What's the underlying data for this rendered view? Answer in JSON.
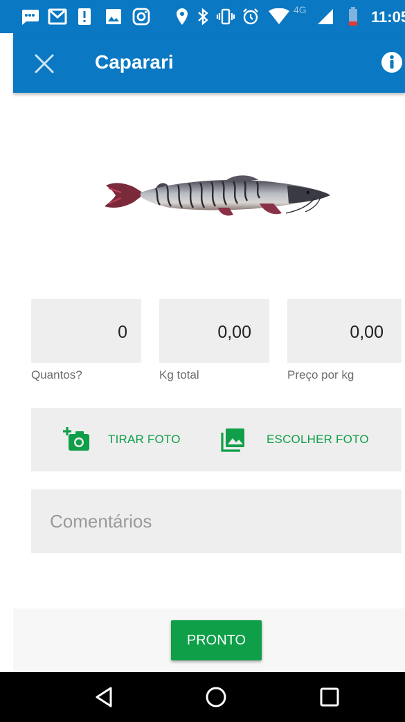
{
  "status_bar": {
    "time": "11:05",
    "network": "4G",
    "icons": [
      "sms-icon",
      "gmail-icon",
      "alert-icon",
      "gallery-icon",
      "instagram-icon",
      "location-icon",
      "bluetooth-icon",
      "vibrate-icon",
      "alarm-icon",
      "wifi-icon",
      "signal-icon",
      "battery-icon"
    ]
  },
  "app_bar": {
    "title": "Caparari",
    "close_icon": "close-icon",
    "info_icon": "info-icon",
    "color": "#0a78c2"
  },
  "fields": {
    "quantity": {
      "value": "0",
      "label": "Quantos?"
    },
    "total_kg": {
      "value": "0,00",
      "label": "Kg total"
    },
    "price_per_kg": {
      "value": "0,00",
      "label": "Preço por kg"
    }
  },
  "photo": {
    "take_label": "TIRAR FOTO",
    "choose_label": "ESCOLHER FOTO",
    "take_icon": "add-camera-icon",
    "choose_icon": "gallery-icon"
  },
  "comments": {
    "placeholder": "Comentários",
    "value": ""
  },
  "done_button": {
    "label": "PRONTO",
    "color": "#0e9f48"
  },
  "nav_bar": {
    "back_icon": "back-icon",
    "home_icon": "home-icon",
    "recents_icon": "recents-icon"
  }
}
